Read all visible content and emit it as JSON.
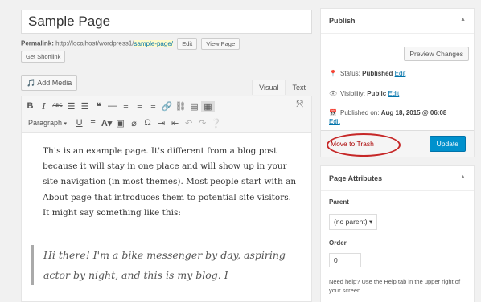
{
  "page": {
    "title": "Sample Page",
    "permalink_label": "Permalink:",
    "permalink_base": "http://localhost/wordpress1/",
    "permalink_slug": "sample-page/",
    "edit_btn": "Edit",
    "view_page_btn": "View Page",
    "shortlink_btn": "Get Shortlink"
  },
  "editor": {
    "add_media": "Add Media",
    "tab_visual": "Visual",
    "tab_text": "Text",
    "format_select": "Paragraph",
    "paragraph": "This is an example page. It's different from a blog post because it will stay in one place and will show up in your site navigation (in most themes). Most people start with an About page that introduces them to potential site visitors. It might say something like this:",
    "quote": "Hi there! I'm a bike messenger by day, aspiring actor by night, and this is my blog. I",
    "toolbar_row1": [
      "B",
      "I",
      "ABC",
      "☰",
      "☰",
      "❝",
      "—",
      "≡",
      "≡",
      "≡",
      "🔗",
      "⛓",
      "▤",
      "▦"
    ],
    "toolbar_row2": [
      "U",
      "≡",
      "A",
      "▾",
      "▣",
      "⌀",
      "Ω",
      "⇥",
      "⇤",
      "↶",
      "↷",
      "❔"
    ]
  },
  "publish": {
    "title": "Publish",
    "preview_btn": "Preview Changes",
    "status_label": "Status:",
    "status_value": "Published",
    "status_edit": "Edit",
    "visibility_label": "Visibility:",
    "visibility_value": "Public",
    "visibility_edit": "Edit",
    "published_label": "Published on:",
    "published_value": "Aug 18, 2015 @ 06:08",
    "published_edit": "Edit",
    "trash_link": "Move to Trash",
    "update_btn": "Update"
  },
  "attributes": {
    "title": "Page Attributes",
    "parent_label": "Parent",
    "parent_value": "(no parent)",
    "order_label": "Order",
    "order_value": "0",
    "help_text": "Need help? Use the Help tab in the upper right of your screen."
  }
}
